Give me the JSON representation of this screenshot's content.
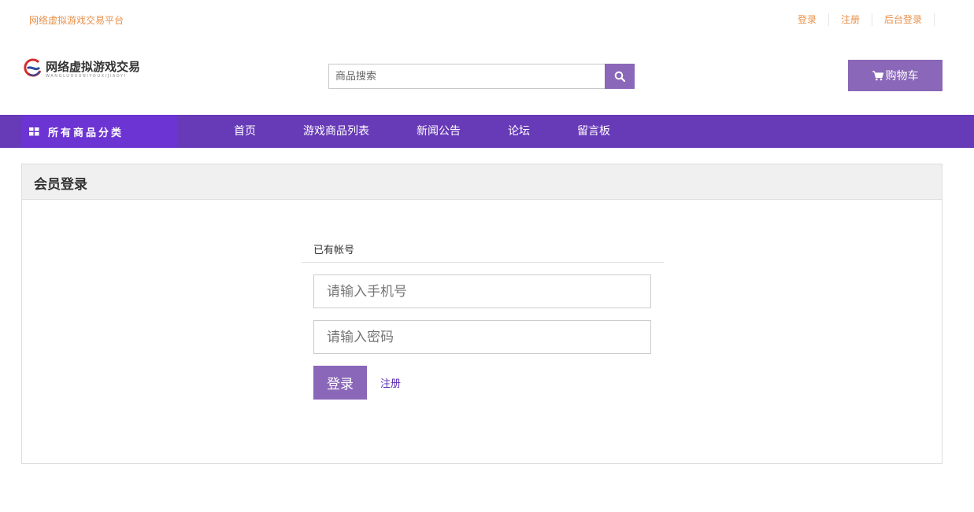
{
  "topbar": {
    "site_name": "网络虚拟游戏交易平台",
    "links": [
      "登录",
      "注册",
      "后台登录"
    ]
  },
  "header": {
    "logo_text": "网络虚拟游戏交易",
    "logo_subtext": "WANGLUOXUNIYOUXIJIAOYI",
    "search_placeholder": "商品搜索",
    "search_icon": "search-icon",
    "cart_label": "购物车",
    "cart_icon": "cart-icon"
  },
  "nav": {
    "category_label": "所有商品分类",
    "category_icon": "grid-icon",
    "items": [
      "首页",
      "游戏商品列表",
      "新闻公告",
      "论坛",
      "留言板"
    ]
  },
  "login": {
    "panel_title": "会员登录",
    "subtitle": "已有帐号",
    "phone_placeholder": "请输入手机号",
    "password_placeholder": "请输入密码",
    "login_button": "登录",
    "register_link": "注册"
  },
  "colors": {
    "accent_purple": "#8a67b8",
    "nav_purple": "#673ab7",
    "nav_category": "#6c34d2",
    "top_link_orange": "#e8914a"
  }
}
